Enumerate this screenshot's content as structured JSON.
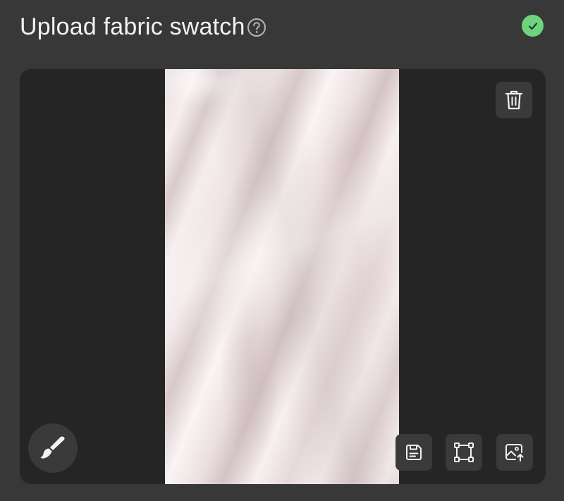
{
  "header": {
    "title": "Upload fabric swatch",
    "help_icon": "question-circle-icon",
    "status_icon": "check-circle-icon",
    "status_color": "#6fd27d"
  },
  "preview": {
    "background": "#252525",
    "swatch_description_color": "#efe4e5"
  },
  "toolbar": {
    "delete_icon": "trash-icon",
    "brush_icon": "paintbrush-icon",
    "save_icon": "save-icon",
    "crop_icon": "crop-frame-icon",
    "replace_icon": "image-upload-icon",
    "button_color": "#3a3a3a"
  }
}
